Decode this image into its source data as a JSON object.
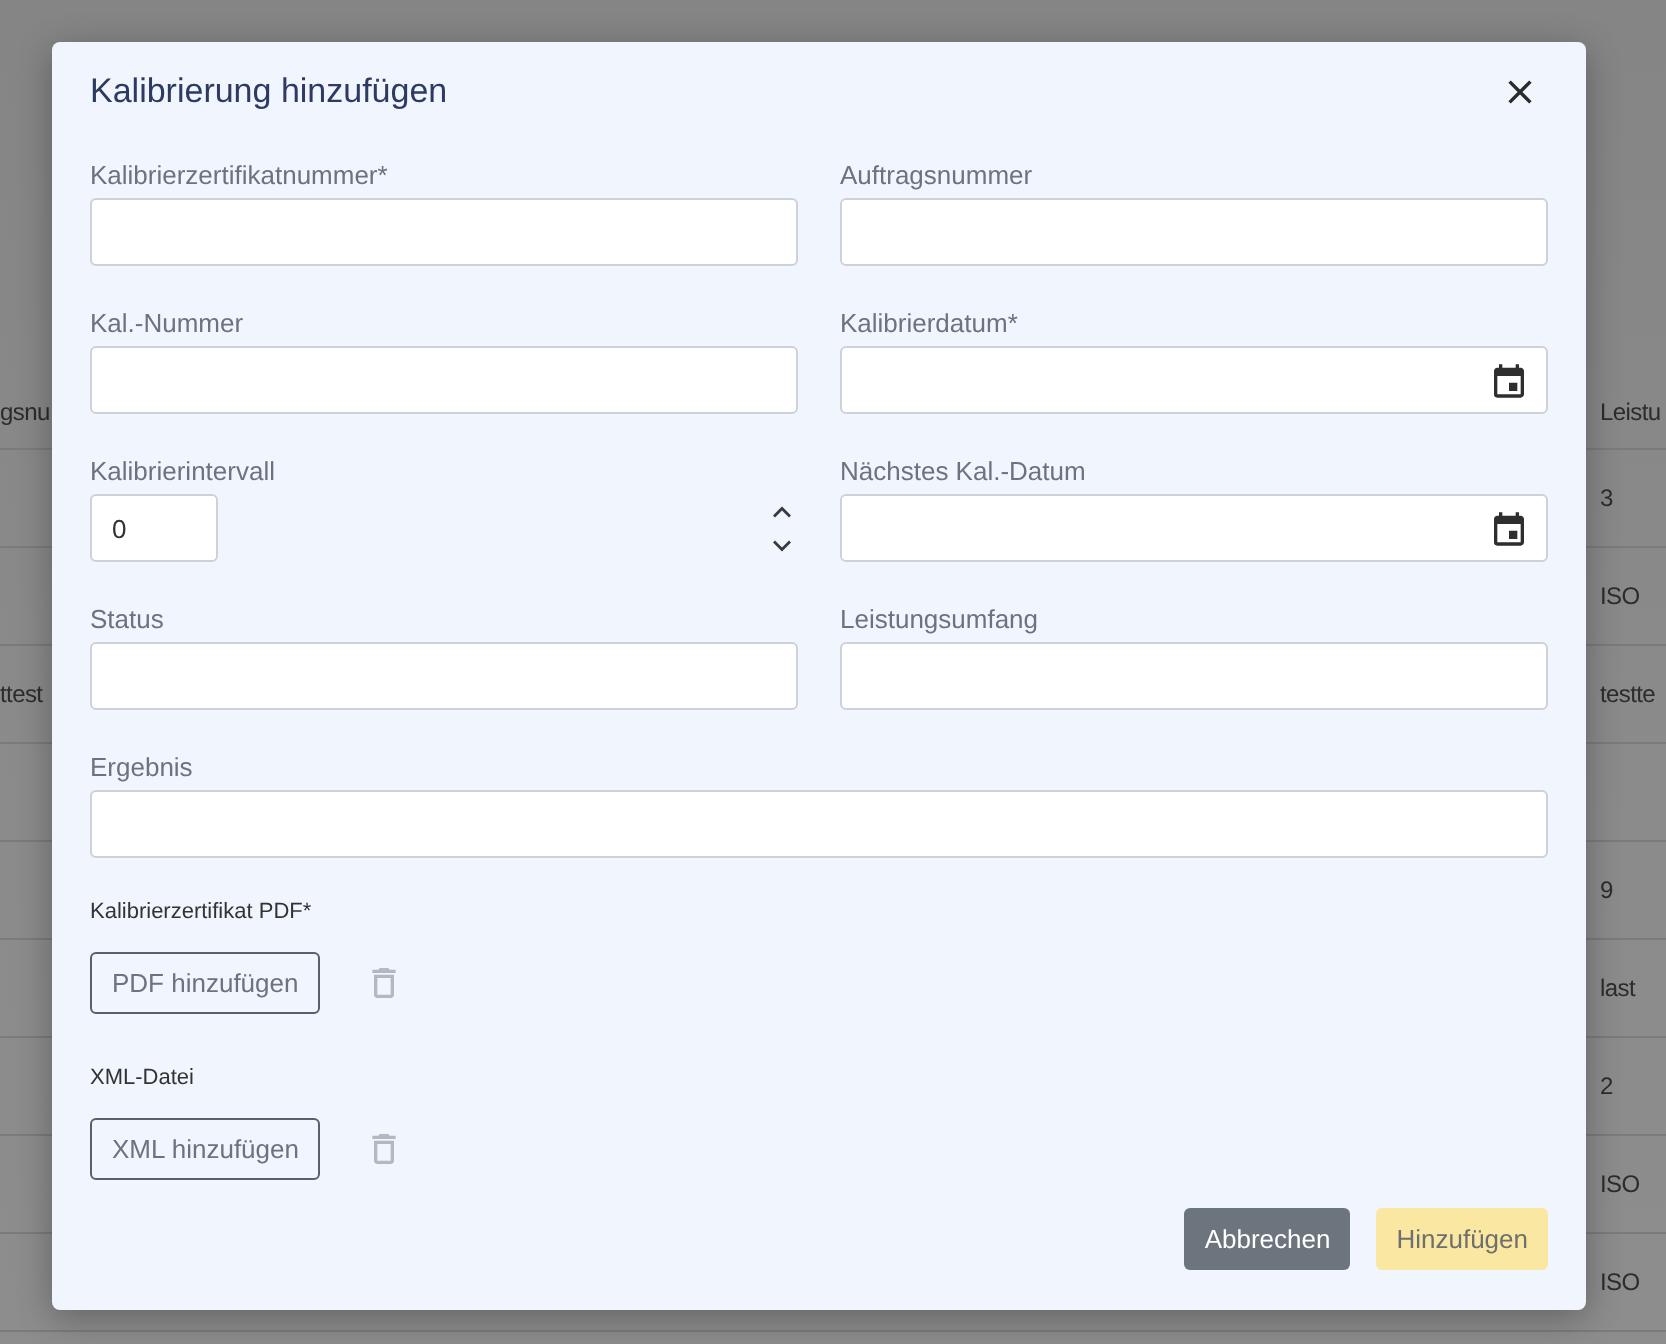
{
  "background_table": {
    "header": {
      "column_1": "gsnu",
      "column_2": "Leistu"
    },
    "rows": [
      {
        "column_2": "3"
      },
      {
        "column_2": "ISO"
      },
      {
        "column_1": "ttest",
        "column_2": "testte"
      },
      {},
      {
        "column_2": "9"
      },
      {
        "column_2": "last"
      },
      {
        "column_2": "2"
      },
      {
        "column_2": "ISO"
      },
      {
        "column_2": "ISO"
      }
    ]
  },
  "dialog": {
    "title": "Kalibrierung hinzufügen",
    "fields": [
      {
        "label": "Kalibrierzertifikatnummer*",
        "kind": "text"
      },
      {
        "label": "Auftragsnummer",
        "kind": "text"
      },
      {
        "label": "Kal.-Nummer",
        "kind": "text"
      },
      {
        "label": "Kalibrierdatum*",
        "kind": "date"
      },
      {
        "label": "Kalibrierintervall",
        "kind": "number",
        "value": "0"
      },
      {
        "label": "Nächstes Kal.-Datum",
        "kind": "date"
      },
      {
        "label": "Status",
        "kind": "text"
      },
      {
        "label": "Leistungsumfang",
        "kind": "text"
      },
      {
        "label": "Ergebnis",
        "kind": "wide_text"
      }
    ],
    "uploads": [
      {
        "label": "Kalibrierzertifikat PDF*",
        "button": "PDF hinzufügen"
      },
      {
        "label": "XML-Datei",
        "button": "XML hinzufügen"
      }
    ],
    "buttons": [
      {
        "label": "Abbrechen",
        "kind": "secondary",
        "disabled": false
      },
      {
        "label": "Hinzufügen",
        "kind": "primary",
        "disabled": true
      }
    ]
  }
}
